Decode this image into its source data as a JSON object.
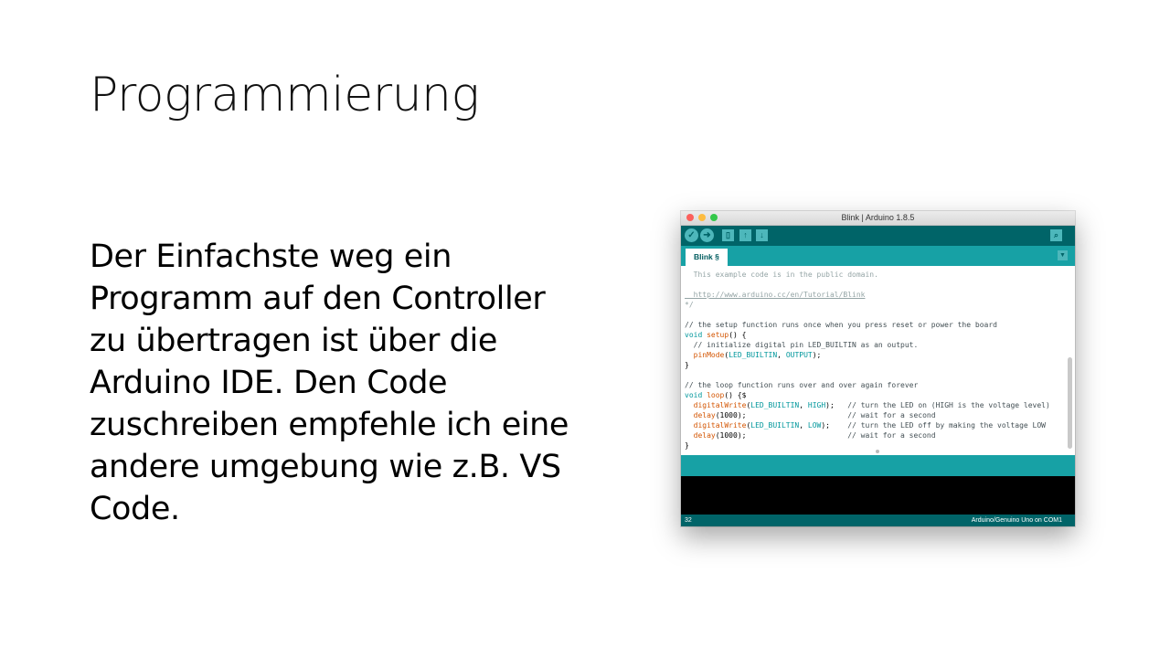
{
  "slide": {
    "title": "Programmierung",
    "body": "Der Einfachste weg ein\nProgramm auf den Controller\nzu übertragen ist über die\nArduino IDE. Den Code\nzuschreiben empfehle ich eine\nandere umgebung wie z.B. VS\nCode."
  },
  "ide": {
    "window_title": "Blink | Arduino 1.8.5",
    "toolbar": {
      "verify_icon": "checkmark-icon",
      "upload_icon": "arrow-right-icon",
      "new_icon": "new-file-icon",
      "open_icon": "arrow-up-icon",
      "save_icon": "arrow-down-icon",
      "serial_icon": "magnifier-icon"
    },
    "tab_label": "Blink §",
    "code": {
      "l1": "  This example code is in the public domain.",
      "l2": "",
      "l3": "  http://www.arduino.cc/en/Tutorial/Blink",
      "l4": "*/",
      "l5": "",
      "l6": "// the setup function runs once when you press reset or power the board",
      "l7_kw": "void",
      "l7_fn": "setup",
      "l7_rest": "() {",
      "l8": "  // initialize digital pin LED_BUILTIN as an output.",
      "l9_fn": "pinMode",
      "l9_a": "LED_BUILTIN",
      "l9_b": "OUTPUT",
      "l10": "}",
      "l11": "",
      "l12": "// the loop function runs over and over again forever",
      "l13_kw": "void",
      "l13_fn": "loop",
      "l13_rest": "() {$",
      "l14_fn": "digitalWrite",
      "l14_a": "LED_BUILTIN",
      "l14_b": "HIGH",
      "l14_c": "// turn the LED on (HIGH is the voltage level)",
      "l15_fn": "delay",
      "l15_v": "(1000);",
      "l15_c": "// wait for a second",
      "l16_fn": "digitalWrite",
      "l16_a": "LED_BUILTIN",
      "l16_b": "LOW",
      "l16_c": "// turn the LED off by making the voltage LOW",
      "l17_fn": "delay",
      "l17_v": "(1000);",
      "l17_c": "// wait for a second",
      "l18": "}"
    },
    "footer": {
      "line_number": "32",
      "board": "Arduino/Genuino Uno on COM1"
    }
  }
}
